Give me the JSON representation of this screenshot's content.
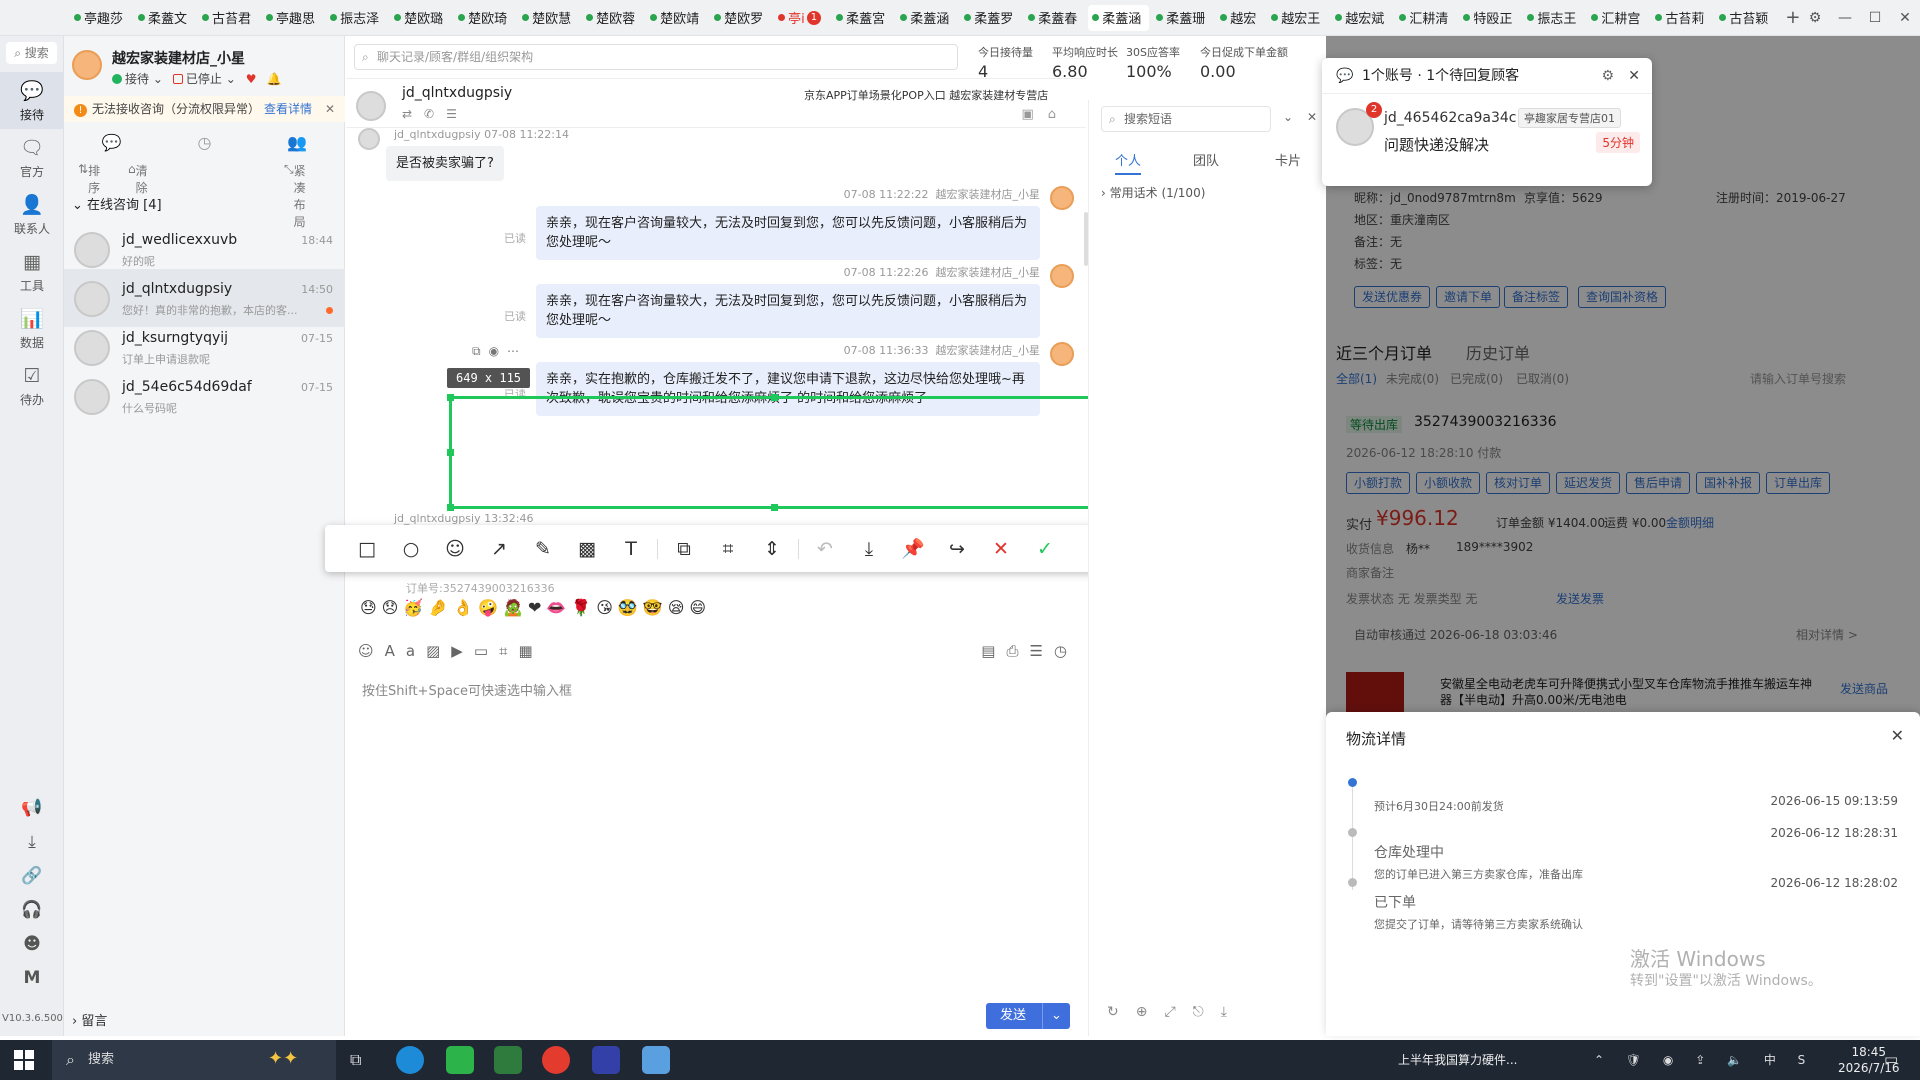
{
  "tabs": [
    "亭趣莎",
    "柔蓋文",
    "古苔君",
    "亭趣思",
    "振志泽",
    "楚欧璐",
    "楚欧琦",
    "楚欧慧",
    "楚欧蓉",
    "楚欧靖",
    "楚欧罗",
    "亭i",
    "柔蓋宮",
    "柔蓋涵",
    "柔蓋罗",
    "柔蓋春",
    "柔蓋涵",
    "柔蓋珊",
    "越宏",
    "越宏王",
    "越宏斌",
    "汇耕清",
    "特殴正",
    "振志王",
    "汇耕宫",
    "古苔莉",
    "古苔颖"
  ],
  "tab_badge": "1",
  "window_controls": {
    "gear": "⚙",
    "min": "—",
    "max": "☐",
    "close": "✕"
  },
  "rail": {
    "search": "搜索",
    "items": [
      {
        "label": "接待",
        "icon": "💬"
      },
      {
        "label": "官方",
        "icon": "🗨"
      },
      {
        "label": "联系人",
        "icon": "👤"
      },
      {
        "label": "工具",
        "icon": "▦"
      },
      {
        "label": "数据",
        "icon": "📊"
      },
      {
        "label": "待办",
        "icon": "☑"
      }
    ],
    "bottom_icons": [
      "📢",
      "⤓",
      "🔗",
      "🎧",
      "☻",
      "M"
    ],
    "version": "V10.3.6.500"
  },
  "shop": {
    "name": "越宏家装建材店_小星",
    "status_reception": "接待",
    "status_stopped": "已停止",
    "warning": "无法接收咨询（分流权限异常）",
    "warning_link": "查看详情"
  },
  "list_tools": {
    "sort": "排序",
    "clear": "清除",
    "layout": "紧凑布局"
  },
  "group_head": "在线咨询 [4]",
  "conversations": [
    {
      "name": "jd_wedlicexxuvb",
      "preview": "好的呢",
      "time": "18:44"
    },
    {
      "name": "jd_qlntxdugpsiy",
      "preview": "您好！真的非常的抱歉，本店的客...",
      "time": "14:50"
    },
    {
      "name": "jd_ksurngtyqyij",
      "preview": "订单上申请退款呢",
      "time": "07-15"
    },
    {
      "name": "jd_54e6c54d69daf",
      "preview": "什么号码呢",
      "time": "07-15"
    }
  ],
  "leave_msg": "留言",
  "chat": {
    "search_placeholder": "聊天记录/顾客/群组/组织架构",
    "stats": [
      {
        "label": "今日接待量",
        "value": "4"
      },
      {
        "label": "平均响应时长",
        "value": "6.80"
      },
      {
        "label": "30S应答率",
        "value": "100%"
      },
      {
        "label": "今日促成下单金额",
        "value": "0.00"
      }
    ],
    "customer": "jd_qlntxdugpsiy",
    "source": "京东APP订单场景化POP入口  越宏家装建材专营店",
    "messages": [
      {
        "who": "jd_qlntxdugpsiy",
        "time": "07-08 11:22:14",
        "text": "是否被卖家骗了?"
      },
      {
        "who": "越宏家装建材店_小星",
        "time": "07-08 11:22:22",
        "text": "亲亲，现在客户咨询量较大，无法及时回复到您，您可以先反馈问题，小客服稍后为您处理呢～",
        "read": "已读"
      },
      {
        "who": "越宏家装建材店_小星",
        "time": "07-08 11:22:26",
        "text": "亲亲，现在客户咨询量较大，无法及时回复到您，您可以先反馈问题，小客服稍后为您处理呢～",
        "read": "已读"
      },
      {
        "who": "越宏家装建材店_小星",
        "time": "07-08 11:36:33",
        "text": "亲亲，实在抱歉的，仓库搬迁发不了，建议您申请下退款，这边尽快给您处理哦~再次致歉，耽误您宝贵的时间和给您添麻烦了 的时间和给您添麻烦了",
        "read": "已读"
      }
    ],
    "next_peek": "jd_qlntxdugpsiy  13:32:46",
    "order_ghost": "订单号:3527439003216336",
    "emojis": "😓😞🥳🤌👌🤪🧟❤👄🌹😘🥸🤓😪😄",
    "input_hint": "按住Shift+Space可快速选中输入框",
    "send": "发送",
    "send_arrow": "⌄"
  },
  "screenshot": {
    "size": "649 x 115",
    "tools": [
      "□",
      "○",
      "☺",
      "↗",
      "✎",
      "▩",
      "T",
      "⧉",
      "⌗",
      "⇕",
      "↶",
      "⤓",
      "📌",
      "↪",
      "✕",
      "✓"
    ]
  },
  "phrase": {
    "search_placeholder": "搜索短语",
    "tabs": [
      "个人",
      "团队",
      "卡片"
    ],
    "category": "常用话术 (1/100)"
  },
  "notification": {
    "header": "1个账号 · 1个待回复顾客",
    "badge": "2",
    "user": "jd_465462ca9a34c",
    "shop": "亭趣家居专营店01",
    "message": "问题快递没解决",
    "time": "5分钟"
  },
  "customer_panel": {
    "nickname_label": "昵称：",
    "nickname": "jd_0nod9787mtrn8m",
    "jingdou_label": "京享值：",
    "jingdou": "5629",
    "register_label": "注册时间：",
    "register": "2019-06-27",
    "region_label": "地区：",
    "region": "重庆潼南区",
    "remark_label": "备注：",
    "remark": "无",
    "tag_label": "标签：",
    "tag": "无",
    "buttons": [
      "发送优惠券",
      "邀请下单",
      "备注标签",
      "查询国补资格"
    ],
    "orders_tab": "近三个月订单",
    "history_tab": "历史订单",
    "filters": [
      "全部(1)",
      "未完成(0)",
      "已完成(0)",
      "已取消(0)"
    ],
    "order_search": "请输入订单号搜索",
    "order_status": "等待出库",
    "order_no": "3527439003216336",
    "order_time": "2026-06-12 18:28:10 付款",
    "order_buttons": [
      "小额打款",
      "小额收款",
      "核对订单",
      "延迟发货",
      "售后申请",
      "国补补报",
      "订单出库"
    ],
    "paid_label": "实付",
    "paid": "¥996.12",
    "total": "订单金额 ¥1404.00",
    "freight": "运费 ¥0.00",
    "amount_detail": "金额明细",
    "receiver_label": "收货信息",
    "receiver": "杨**",
    "phone": "189****3902",
    "seller_remark": "商家备注",
    "ship_state": "发票状态  无  发票类型  无",
    "ship_link": "发送发票",
    "auto_review": "自动审核通过  2026-06-18 03:03:46",
    "order_detail": "相对详情 >",
    "product": "安徽星全电动老虎车可升降便携式小型叉车仓库物流手推推车搬运车神器【半电动】升高0.00米/无电池电",
    "send_product": "发送商品"
  },
  "logistics": {
    "title": "物流详情",
    "steps": [
      {
        "title": "",
        "desc": "预计6月30日24:00前发货",
        "time": "2026-06-15 09:13:59"
      },
      {
        "title": "仓库处理中",
        "desc": "您的订单已进入第三方卖家仓库，准备出库",
        "time": "2026-06-12 18:28:31"
      },
      {
        "title": "已下单",
        "desc": "您提交了订单，请等待第三方卖家系统确认",
        "time": "2026-06-12 18:28:02"
      }
    ]
  },
  "watermark": {
    "line1": "激活 Windows",
    "line2": "转到\"设置\"以激活 Windows。"
  },
  "taskbar": {
    "search": "搜索",
    "news": "上半年我国算力硬件...",
    "tray_icons": "⌃ 🛡 ◉ ⇪ 🔈 中 S",
    "time": "18:45",
    "date": "2026/7/16"
  },
  "colors": {
    "accent": "#3474d4",
    "select": "#1fc85a",
    "danger": "#e0352b"
  }
}
